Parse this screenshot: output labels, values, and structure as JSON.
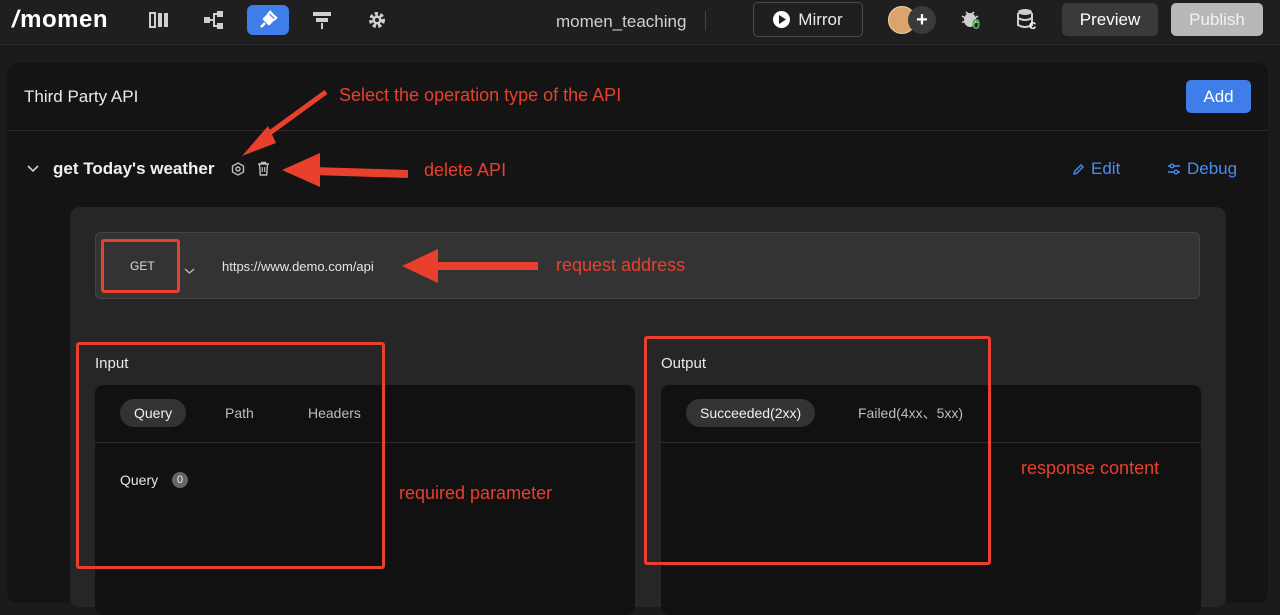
{
  "topbar": {
    "logo": "momen",
    "project_name": "momen_teaching",
    "mirror_label": "Mirror",
    "bug_count": "0",
    "db_badge": "c",
    "preview_label": "Preview",
    "publish_label": "Publish",
    "nav_icons": [
      "pages-icon",
      "logic-flow-icon",
      "api-plug-icon",
      "data-model-icon",
      "settings-gear-icon"
    ],
    "active_nav": "api-plug-icon",
    "accent_color": "#3f7de8"
  },
  "panel": {
    "title": "Third Party API",
    "add_label": "Add"
  },
  "api": {
    "name": "get Today's weather",
    "edit_label": "Edit",
    "debug_label": "Debug",
    "method": "GET",
    "url": "https://www.demo.com/api"
  },
  "input": {
    "title": "Input",
    "tabs": [
      "Query",
      "Path",
      "Headers"
    ],
    "active_tab": "Query",
    "query_label": "Query",
    "query_count": "0"
  },
  "output": {
    "title": "Output",
    "tabs": [
      "Succeeded(2xx)",
      "Failed(4xx、5xx)"
    ],
    "active_tab": "Succeeded(2xx)"
  },
  "annotations": {
    "operation_type": "Select the operation type of the API",
    "delete_api": "delete API",
    "request_address": "request address",
    "required_parameter": "required parameter",
    "response_content": "response content",
    "color": "#e8402c"
  }
}
